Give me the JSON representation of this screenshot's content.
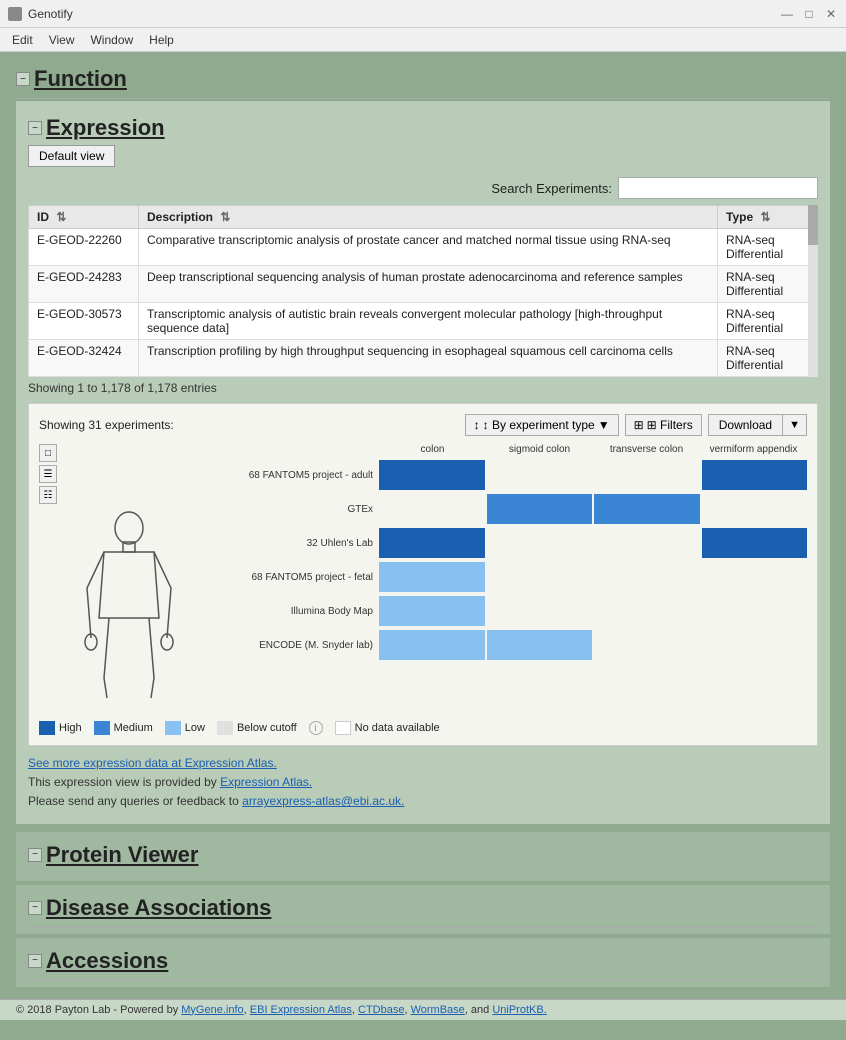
{
  "app": {
    "title": "Genotify",
    "icon": "G"
  },
  "titlebar": {
    "title": "Genotify",
    "minimize": "—",
    "maximize": "□",
    "close": "✕"
  },
  "menubar": {
    "items": [
      "Edit",
      "View",
      "Window",
      "Help"
    ]
  },
  "function_section": {
    "toggle": "−",
    "title": "Function"
  },
  "expression_section": {
    "toggle": "−",
    "title": "Expression",
    "default_view_btn": "Default view",
    "search_label": "Search Experiments:",
    "search_placeholder": "",
    "table": {
      "columns": [
        "ID",
        "Description",
        "Type"
      ],
      "rows": [
        {
          "id": "E-GEOD-22260",
          "description": "Comparative transcriptomic analysis of prostate cancer and matched normal tissue using RNA-seq",
          "type": "RNA-seq Differential"
        },
        {
          "id": "E-GEOD-24283",
          "description": "Deep transcriptional sequencing analysis of human prostate adenocarcinoma and reference samples",
          "type": "RNA-seq Differential"
        },
        {
          "id": "E-GEOD-30573",
          "description": "Transcriptomic analysis of autistic brain reveals convergent molecular pathology [high-throughput sequence data]",
          "type": "RNA-seq Differential"
        },
        {
          "id": "E-GEOD-32424",
          "description": "Transcription profiling by high throughput sequencing in esophageal squamous cell carcinoma cells",
          "type": "RNA-seq Differential"
        }
      ],
      "showing_text": "Showing 1 to 1,178 of 1,178 entries"
    },
    "heatmap": {
      "showing_text": "Showing 31 experiments:",
      "sort_btn": "↕ By experiment type",
      "filter_btn": "⊞ Filters",
      "download_btn": "Download",
      "columns": [
        "colon",
        "sigmoid colon",
        "transverse colon",
        "vermiform appendix"
      ],
      "rows": [
        {
          "label": "68 FANTOM5 project - adult",
          "cells": [
            "high",
            "empty",
            "empty",
            "high"
          ]
        },
        {
          "label": "GTEx",
          "cells": [
            "empty",
            "medium",
            "medium",
            "empty"
          ]
        },
        {
          "label": "32 Uhlen's Lab",
          "cells": [
            "high",
            "empty",
            "empty",
            "high"
          ]
        },
        {
          "label": "68 FANTOM5 project - fetal",
          "cells": [
            "low",
            "empty",
            "empty",
            "empty"
          ]
        },
        {
          "label": "Illumina Body Map",
          "cells": [
            "low",
            "empty",
            "empty",
            "empty"
          ]
        },
        {
          "label": "ENCODE (M. Snyder lab)",
          "cells": [
            "low",
            "low",
            "empty",
            "empty"
          ]
        }
      ],
      "legend": [
        {
          "label": "High",
          "color": "#1a5fb0"
        },
        {
          "label": "Medium",
          "color": "#3a86d4"
        },
        {
          "label": "Low",
          "color": "#88c0f0"
        },
        {
          "label": "Below cutoff",
          "color": "#e0e0e0"
        },
        {
          "label": "No data available",
          "color": "transparent",
          "border": true
        }
      ]
    },
    "links": {
      "atlas_link_text": "See more expression data at Expression Atlas.",
      "note1": "This expression view is provided by",
      "note1_link": "Expression Atlas.",
      "note2": "Please send any queries or feedback to",
      "note2_email": "arrayexpress-atlas@ebi.ac.uk."
    }
  },
  "protein_viewer_section": {
    "toggle": "−",
    "title": "Protein Viewer"
  },
  "disease_section": {
    "toggle": "−",
    "title": "Disease Associations"
  },
  "accessions_section": {
    "toggle": "−",
    "title": "Accessions"
  },
  "footer": {
    "text": "© 2018 Payton Lab - Powered by",
    "links": [
      "MyGene.info",
      "EBI Expression Atlas",
      "CTDbase",
      "WormBase",
      "and",
      "UniProtKB."
    ]
  }
}
